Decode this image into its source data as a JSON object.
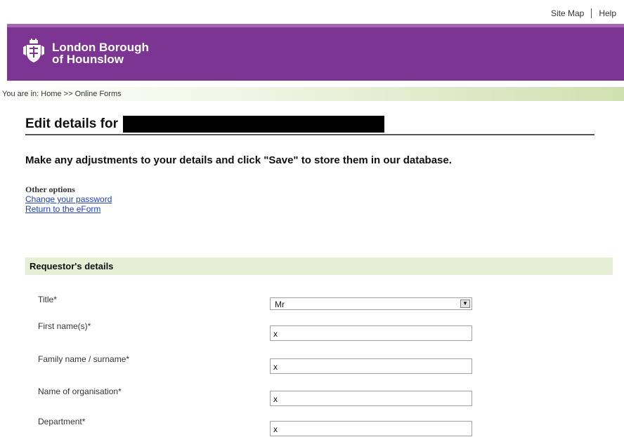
{
  "utility_nav": {
    "site_map": "Site Map",
    "help": "Help"
  },
  "banner": {
    "line1": "London Borough",
    "line2": "of Hounslow",
    "color": "#7d3594"
  },
  "breadcrumb": {
    "prefix": "You are in:",
    "home": "Home",
    "separator": ">>",
    "current": "Online Forms"
  },
  "page": {
    "title": "Edit details for",
    "instructions": "Make any adjustments to your details and click \"Save\" to store them in our database."
  },
  "other_options": {
    "heading": "Other options",
    "change_password": "Change your password",
    "return_eform": "Return to the eForm"
  },
  "section": {
    "title": "Requestor's details"
  },
  "fields": {
    "title": {
      "label": "Title*",
      "value": "Mr"
    },
    "first_name": {
      "label": "First name(s)*",
      "value": "x"
    },
    "family_name": {
      "label": "Family name / surname*",
      "value": "x"
    },
    "organisation": {
      "label": "Name of organisation*",
      "value": "x"
    },
    "department": {
      "label": "Department*",
      "value": "x"
    }
  },
  "colors": {
    "banner_purple": "#7d3594",
    "section_green": "#e6efd6",
    "link_blue": "#1f3fbf"
  }
}
